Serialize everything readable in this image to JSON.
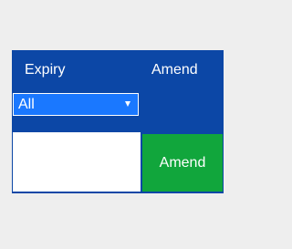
{
  "headers": {
    "expiry": "Expiry",
    "amend": "Amend"
  },
  "expiry_select": {
    "value": "All",
    "icon": "chevron-down-icon"
  },
  "expiry_input": {
    "value": "",
    "placeholder": ""
  },
  "amend_button": {
    "label": "Amend"
  },
  "colors": {
    "page_background": "#eeeeee",
    "panel_background": "#0c47a6",
    "select_background": "#1a78ff",
    "input_background": "#ffffff",
    "button_background": "#11a63c",
    "text_on_color": "#ffffff"
  }
}
